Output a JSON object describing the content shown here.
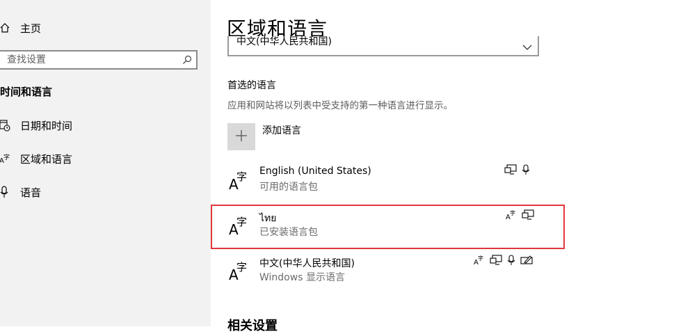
{
  "sidebar": {
    "home_label": "主页",
    "search_placeholder": "查找设置",
    "section_title": "时间和语言",
    "items": [
      {
        "label": "日期和时间",
        "icon": "calendar-clock-icon"
      },
      {
        "label": "区域和语言",
        "icon": "language-icon"
      },
      {
        "label": "语音",
        "icon": "microphone-icon"
      }
    ]
  },
  "main": {
    "title": "区域和语言",
    "display_language_value": "中文(中华人民共和国)",
    "preferred_heading": "首选的语言",
    "description": "应用和网站将以列表中受支持的第一种语言进行显示。",
    "add_language_label": "添加语言",
    "languages": [
      {
        "name": "English (United States)",
        "status": "可用的语言包",
        "features": [
          "display-language-icon",
          "speech-icon"
        ]
      },
      {
        "name": "ไทย",
        "status": "已安装语言包",
        "features": [
          "text-to-speech-icon",
          "display-language-icon"
        ]
      },
      {
        "name": "中文(中华人民共和国)",
        "status": "Windows 显示语言",
        "features": [
          "text-to-speech-icon",
          "display-language-icon",
          "speech-icon",
          "handwriting-icon"
        ]
      }
    ],
    "related_heading": "相关设置"
  },
  "colors": {
    "sidebar_bg": "#f2f2f2",
    "highlight_border": "#e0373d",
    "add_button_bg": "#d9d9d9"
  }
}
